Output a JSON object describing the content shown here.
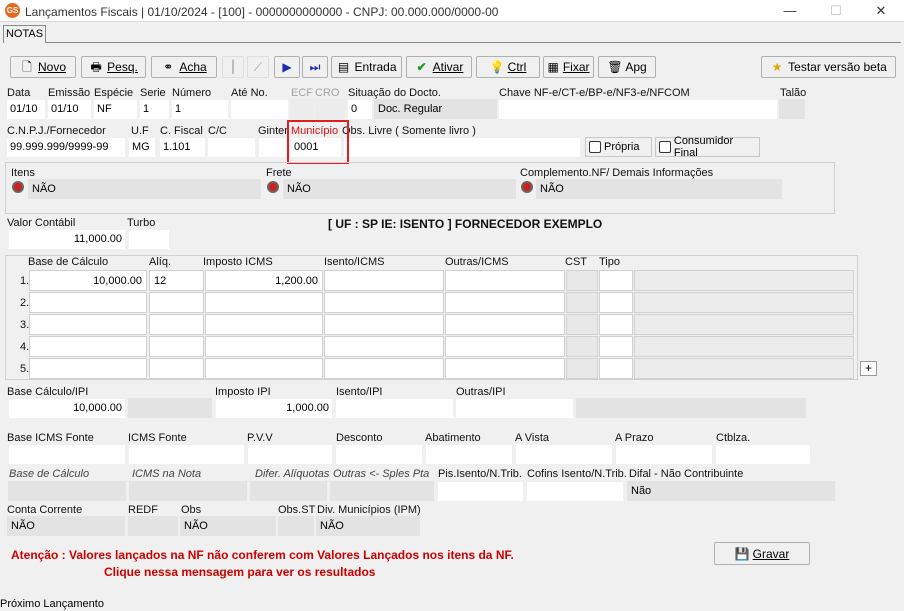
{
  "window": {
    "title": "Lançamentos Fiscais |  01/10/2024 - [100] - 0000000000000 - CNPJ: 00.000.000/0000-00",
    "logo": "GS",
    "minimize": "—",
    "maximize": "☐",
    "close": "✕"
  },
  "tabs": [
    {
      "label": "NOTAS"
    }
  ],
  "toolbar": {
    "novo": "Novo",
    "pesq": "Pesq.",
    "acha": "Acha",
    "entrada": "Entrada",
    "ativar": "Ativar",
    "ctrl": "Ctrl",
    "fixar": "Fixar",
    "apg": "Apg",
    "beta": "Testar versão beta"
  },
  "labels": {
    "data": "Data",
    "emissao": "Emissão",
    "especie": "Espécie",
    "serie": "Serie",
    "numero": "Número",
    "ate_no": "Até No.",
    "ecf": "ECF",
    "cro": "CRO",
    "situacao": "Situação do Docto.",
    "chave": "Chave NF-e/CT-e/BP-e/NF3-e/NFCOM",
    "talao": "Talão",
    "cnpj": "C.N.P.J./Fornecedor",
    "uf": "U.F",
    "cfiscal": "C. Fiscal",
    "cc": "C/C",
    "ginter": "Ginter",
    "municipio": "Município",
    "obs_livre": "Obs. Livre ( Somente livro )",
    "itens": "Itens",
    "frete": "Frete",
    "complemento": "Complemento.NF/ Demais Informações",
    "valor_contabil": "Valor Contábil",
    "turbo": "Turbo",
    "base_calculo": "Base de Cálculo",
    "aliq": "Alíq.",
    "imposto_icms": "Imposto ICMS",
    "isento_icms": "Isento/ICMS",
    "outras_icms": "Outras/ICMS",
    "cst": "CST",
    "tipo": "Tipo",
    "base_ipi": "Base Cálculo/IPI",
    "imposto_ipi": "Imposto IPI",
    "isento_ipi": "Isento/IPI",
    "outras_ipi": "Outras/IPI",
    "base_icms_fonte": "Base ICMS Fonte",
    "icms_fonte": "ICMS Fonte",
    "pvv": "P.V.V",
    "desconto": "Desconto",
    "abatimento": "Abatimento",
    "a_vista": "A Vista",
    "a_prazo": "A Prazo",
    "ctblza": "Ctblza.",
    "base_calc_it": "Base de Cálculo",
    "icms_nota": "ICMS na Nota",
    "difer_aliq": "Difer. Alíquotas",
    "outras_sples": "Outras <- Sples Pta",
    "pis_isento": "Pis.Isento/N.Trib.",
    "cofins_isento": "Cofins Isento/N.Trib.",
    "difal": "Difal - Não Contribuinte",
    "conta_corrente": "Conta Corrente",
    "redf": "REDF",
    "obs": "Obs",
    "obs_st": "Obs.ST",
    "div_municipios": "Div. Municípios (IPM)"
  },
  "values": {
    "data": "01/10",
    "emissao": "01/10",
    "especie": "NF",
    "serie": "1",
    "numero": "1",
    "situacao_code": "0",
    "situacao_desc": "Doc. Regular",
    "cnpj": "99.999.999/9999-99",
    "uf": "MG",
    "cfiscal": "1.101",
    "municipio": "0001",
    "itens": "NÃO",
    "frete": "NÃO",
    "complemento": "NÃO",
    "valor_contabil": "11,000.00",
    "base_ipi": "10,000.00",
    "imposto_ipi": "1,000.00",
    "difal": "Não",
    "conta_corrente": "NÃO",
    "obs": "NÃO",
    "div_municipios": "NÃO"
  },
  "checkboxes": {
    "propria": "Própria",
    "consumidor_final": "Consumidor Final"
  },
  "info_line": "[ UF : SP IE: ISENTO ] FORNECEDOR EXEMPLO",
  "grid_rows": [
    {
      "n": "1.",
      "base": "10,000.00",
      "aliq": "12",
      "imposto": "1,200.00"
    },
    {
      "n": "2.",
      "base": "",
      "aliq": "",
      "imposto": ""
    },
    {
      "n": "3.",
      "base": "",
      "aliq": "",
      "imposto": ""
    },
    {
      "n": "4.",
      "base": "",
      "aliq": "",
      "imposto": ""
    },
    {
      "n": "5.",
      "base": "",
      "aliq": "",
      "imposto": ""
    }
  ],
  "plus_button": "+",
  "warning": {
    "line1": "Atenção : Valores lançados na NF não conferem com Valores Lançados nos itens da NF.",
    "line2": "Clique nessa mensagem para ver os resultados"
  },
  "gravar": "Gravar",
  "status": "Próximo  Lançamento"
}
